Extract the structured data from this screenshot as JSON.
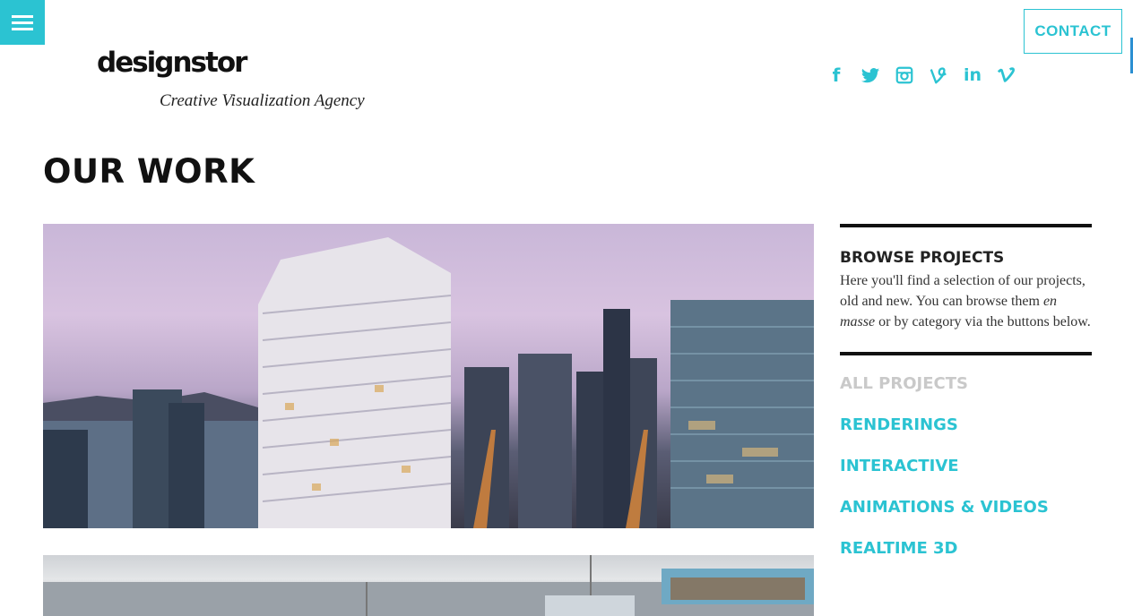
{
  "header": {
    "menu_icon": "hamburger-icon",
    "contact_label": "CONTACT",
    "logo_text": "designstor",
    "logo_tagline": "Creative Visualization Agency",
    "social": [
      {
        "name": "facebook-icon",
        "glyph": "f"
      },
      {
        "name": "twitter-icon",
        "glyph": "twitter"
      },
      {
        "name": "instagram-icon",
        "glyph": "instagram"
      },
      {
        "name": "vine-icon",
        "glyph": "V"
      },
      {
        "name": "linkedin-icon",
        "glyph": "in"
      },
      {
        "name": "vimeo-icon",
        "glyph": "v"
      }
    ]
  },
  "main": {
    "title": "OUR WORK"
  },
  "sidebar": {
    "browse_title": "BROWSE PROJECTS",
    "browse_text_1": "Here you'll find a selection of our projects, old and new. You can browse them ",
    "browse_text_em": "en masse",
    "browse_text_2": " or by category via the buttons below.",
    "categories": [
      {
        "label": "ALL PROJECTS",
        "active": true
      },
      {
        "label": "RENDERINGS",
        "active": false
      },
      {
        "label": "INTERACTIVE",
        "active": false
      },
      {
        "label": "ANIMATIONS & VIDEOS",
        "active": false
      },
      {
        "label": "REALTIME 3D",
        "active": false
      }
    ]
  },
  "colors": {
    "accent": "#2bc3d2",
    "inactive": "#c9c9c9",
    "text": "#111111"
  }
}
